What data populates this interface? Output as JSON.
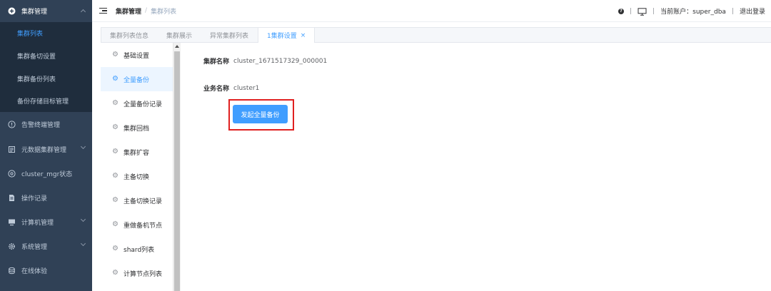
{
  "sidebar": {
    "groups": [
      {
        "label": "集群管理",
        "icon": "plus-circle-icon"
      },
      {
        "label": "告警终端管理",
        "icon": "info-circle-icon"
      },
      {
        "label": "元数据集群管理",
        "icon": "document-icon"
      },
      {
        "label": "cluster_mgr状态",
        "icon": "gear-circle-icon"
      },
      {
        "label": "操作记录",
        "icon": "file-icon"
      },
      {
        "label": "计算机管理",
        "icon": "monitor-icon"
      },
      {
        "label": "系统管理",
        "icon": "gear-icon"
      },
      {
        "label": "在线体验",
        "icon": "database-icon"
      }
    ],
    "sub_items": [
      {
        "label": "集群列表"
      },
      {
        "label": "集群备切设置"
      },
      {
        "label": "集群备份列表"
      },
      {
        "label": "备份存储目标管理"
      }
    ]
  },
  "header": {
    "breadcrumb": [
      "集群管理",
      "集群列表"
    ],
    "account_label": "当前账户：super_dba",
    "logout_label": "退出登录"
  },
  "tabs": [
    {
      "label": "集群列表信息"
    },
    {
      "label": "集群展示"
    },
    {
      "label": "异常集群列表"
    },
    {
      "label": "1集群设置",
      "close": "×"
    }
  ],
  "settings_menu": [
    {
      "label": "基础设置"
    },
    {
      "label": "全量备份"
    },
    {
      "label": "全量备份记录"
    },
    {
      "label": "集群回档"
    },
    {
      "label": "集群扩容"
    },
    {
      "label": "主备切换"
    },
    {
      "label": "主备切换记录"
    },
    {
      "label": "重做备机节点"
    },
    {
      "label": "shard列表"
    },
    {
      "label": "计算节点列表"
    }
  ],
  "main": {
    "cluster_name_label": "集群名称",
    "cluster_name_value": "cluster_1671517329_000001",
    "business_name_label": "业务名称",
    "business_name_value": "cluster1",
    "start_backup_button": "发起全量备份"
  },
  "colors": {
    "sidebar_bg": "#304156",
    "accent": "#409eff",
    "highlight": "#e02020"
  }
}
